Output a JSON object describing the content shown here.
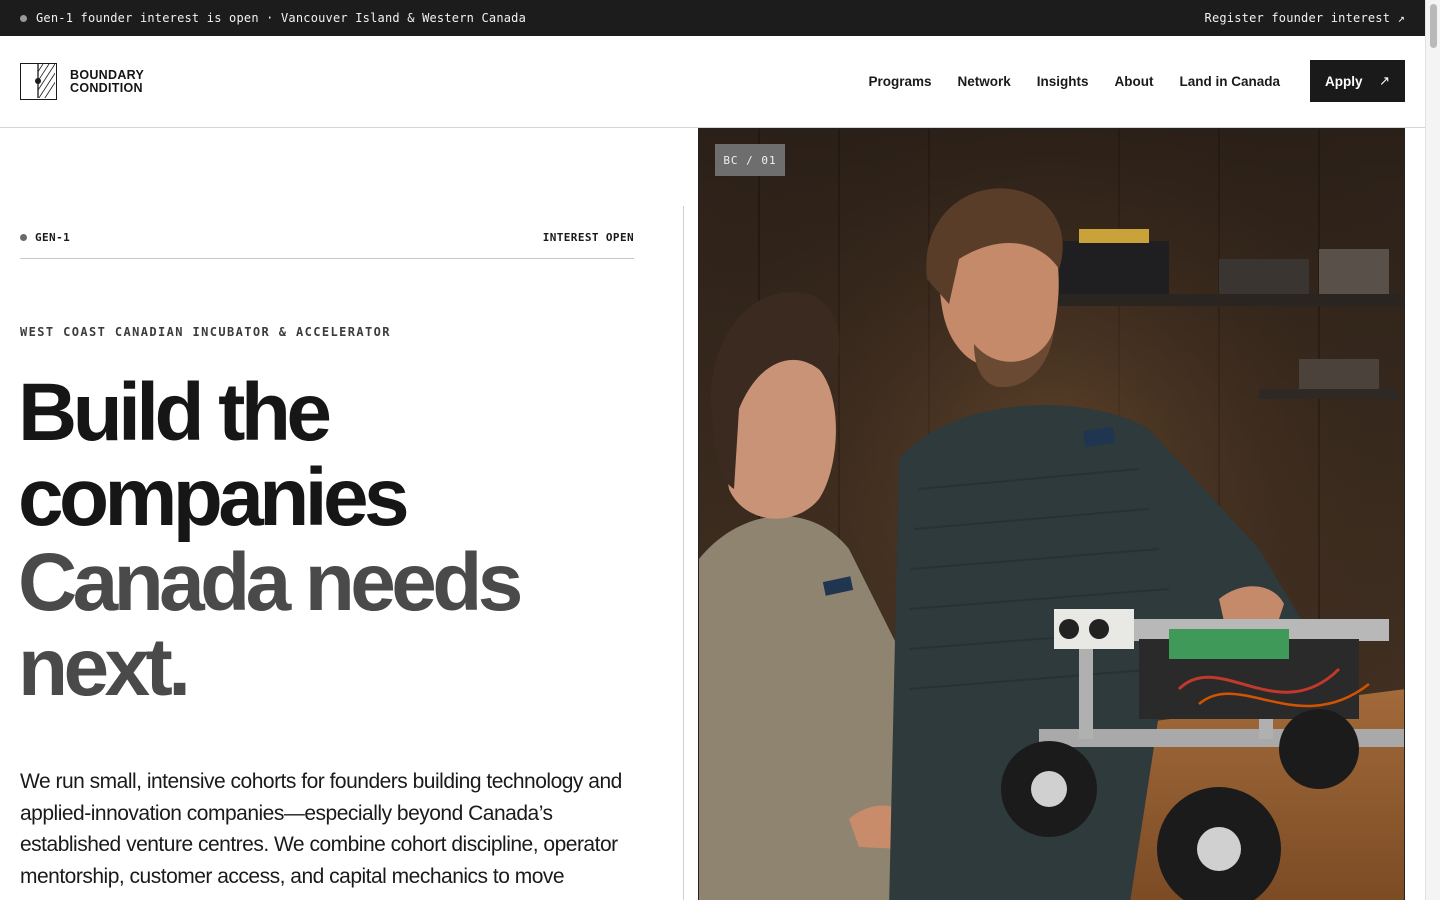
{
  "announcement": {
    "message": "Gen-1 founder interest is open · Vancouver Island & Western Canada",
    "cta": "Register founder interest ↗"
  },
  "brand": {
    "line1": "BOUNDARY",
    "line2": "CONDITION"
  },
  "nav": {
    "items": [
      "Programs",
      "Network",
      "Insights",
      "About",
      "Land in Canada"
    ],
    "apply_label": "Apply",
    "apply_icon": "↗"
  },
  "hero": {
    "cohort_label": "GEN-1",
    "status_label": "INTEREST OPEN",
    "eyebrow": "WEST COAST CANADIAN INCUBATOR & ACCELERATOR",
    "headline_dark_1": "Build the",
    "headline_dark_2": "companies",
    "headline_grey_1": "Canada needs",
    "headline_grey_2": "next.",
    "body": "We run small, intensive cohorts for founders building technology and applied-innovation companies—especially beyond Canada’s established venture centres. We combine cohort discipline, operator mentorship, customer access, and capital mechanics to move"
  },
  "image": {
    "tag": "BC / 01"
  },
  "colors": {
    "topbar_bg": "#1c1c1c",
    "accent_dark": "#1a1a1a",
    "headline_grey": "#4a4a4a"
  }
}
